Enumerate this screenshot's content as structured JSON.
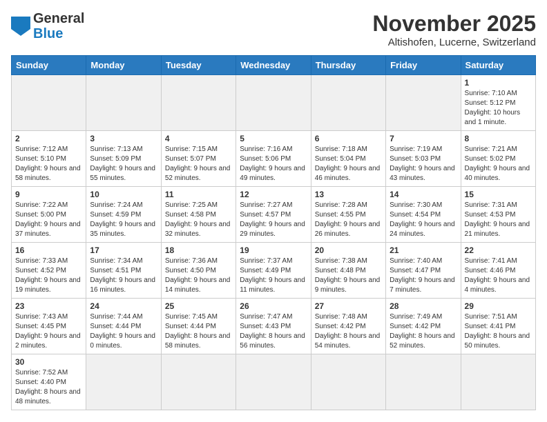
{
  "header": {
    "logo_general": "General",
    "logo_blue": "Blue",
    "month_title": "November 2025",
    "location": "Altishofen, Lucerne, Switzerland"
  },
  "days_of_week": [
    "Sunday",
    "Monday",
    "Tuesday",
    "Wednesday",
    "Thursday",
    "Friday",
    "Saturday"
  ],
  "weeks": [
    [
      {
        "day": "",
        "info": ""
      },
      {
        "day": "",
        "info": ""
      },
      {
        "day": "",
        "info": ""
      },
      {
        "day": "",
        "info": ""
      },
      {
        "day": "",
        "info": ""
      },
      {
        "day": "",
        "info": ""
      },
      {
        "day": "1",
        "info": "Sunrise: 7:10 AM\nSunset: 5:12 PM\nDaylight: 10 hours and 1 minute."
      }
    ],
    [
      {
        "day": "2",
        "info": "Sunrise: 7:12 AM\nSunset: 5:10 PM\nDaylight: 9 hours and 58 minutes."
      },
      {
        "day": "3",
        "info": "Sunrise: 7:13 AM\nSunset: 5:09 PM\nDaylight: 9 hours and 55 minutes."
      },
      {
        "day": "4",
        "info": "Sunrise: 7:15 AM\nSunset: 5:07 PM\nDaylight: 9 hours and 52 minutes."
      },
      {
        "day": "5",
        "info": "Sunrise: 7:16 AM\nSunset: 5:06 PM\nDaylight: 9 hours and 49 minutes."
      },
      {
        "day": "6",
        "info": "Sunrise: 7:18 AM\nSunset: 5:04 PM\nDaylight: 9 hours and 46 minutes."
      },
      {
        "day": "7",
        "info": "Sunrise: 7:19 AM\nSunset: 5:03 PM\nDaylight: 9 hours and 43 minutes."
      },
      {
        "day": "8",
        "info": "Sunrise: 7:21 AM\nSunset: 5:02 PM\nDaylight: 9 hours and 40 minutes."
      }
    ],
    [
      {
        "day": "9",
        "info": "Sunrise: 7:22 AM\nSunset: 5:00 PM\nDaylight: 9 hours and 37 minutes."
      },
      {
        "day": "10",
        "info": "Sunrise: 7:24 AM\nSunset: 4:59 PM\nDaylight: 9 hours and 35 minutes."
      },
      {
        "day": "11",
        "info": "Sunrise: 7:25 AM\nSunset: 4:58 PM\nDaylight: 9 hours and 32 minutes."
      },
      {
        "day": "12",
        "info": "Sunrise: 7:27 AM\nSunset: 4:57 PM\nDaylight: 9 hours and 29 minutes."
      },
      {
        "day": "13",
        "info": "Sunrise: 7:28 AM\nSunset: 4:55 PM\nDaylight: 9 hours and 26 minutes."
      },
      {
        "day": "14",
        "info": "Sunrise: 7:30 AM\nSunset: 4:54 PM\nDaylight: 9 hours and 24 minutes."
      },
      {
        "day": "15",
        "info": "Sunrise: 7:31 AM\nSunset: 4:53 PM\nDaylight: 9 hours and 21 minutes."
      }
    ],
    [
      {
        "day": "16",
        "info": "Sunrise: 7:33 AM\nSunset: 4:52 PM\nDaylight: 9 hours and 19 minutes."
      },
      {
        "day": "17",
        "info": "Sunrise: 7:34 AM\nSunset: 4:51 PM\nDaylight: 9 hours and 16 minutes."
      },
      {
        "day": "18",
        "info": "Sunrise: 7:36 AM\nSunset: 4:50 PM\nDaylight: 9 hours and 14 minutes."
      },
      {
        "day": "19",
        "info": "Sunrise: 7:37 AM\nSunset: 4:49 PM\nDaylight: 9 hours and 11 minutes."
      },
      {
        "day": "20",
        "info": "Sunrise: 7:38 AM\nSunset: 4:48 PM\nDaylight: 9 hours and 9 minutes."
      },
      {
        "day": "21",
        "info": "Sunrise: 7:40 AM\nSunset: 4:47 PM\nDaylight: 9 hours and 7 minutes."
      },
      {
        "day": "22",
        "info": "Sunrise: 7:41 AM\nSunset: 4:46 PM\nDaylight: 9 hours and 4 minutes."
      }
    ],
    [
      {
        "day": "23",
        "info": "Sunrise: 7:43 AM\nSunset: 4:45 PM\nDaylight: 9 hours and 2 minutes."
      },
      {
        "day": "24",
        "info": "Sunrise: 7:44 AM\nSunset: 4:44 PM\nDaylight: 9 hours and 0 minutes."
      },
      {
        "day": "25",
        "info": "Sunrise: 7:45 AM\nSunset: 4:44 PM\nDaylight: 8 hours and 58 minutes."
      },
      {
        "day": "26",
        "info": "Sunrise: 7:47 AM\nSunset: 4:43 PM\nDaylight: 8 hours and 56 minutes."
      },
      {
        "day": "27",
        "info": "Sunrise: 7:48 AM\nSunset: 4:42 PM\nDaylight: 8 hours and 54 minutes."
      },
      {
        "day": "28",
        "info": "Sunrise: 7:49 AM\nSunset: 4:42 PM\nDaylight: 8 hours and 52 minutes."
      },
      {
        "day": "29",
        "info": "Sunrise: 7:51 AM\nSunset: 4:41 PM\nDaylight: 8 hours and 50 minutes."
      }
    ],
    [
      {
        "day": "30",
        "info": "Sunrise: 7:52 AM\nSunset: 4:40 PM\nDaylight: 8 hours and 48 minutes."
      },
      {
        "day": "",
        "info": ""
      },
      {
        "day": "",
        "info": ""
      },
      {
        "day": "",
        "info": ""
      },
      {
        "day": "",
        "info": ""
      },
      {
        "day": "",
        "info": ""
      },
      {
        "day": "",
        "info": ""
      }
    ]
  ]
}
